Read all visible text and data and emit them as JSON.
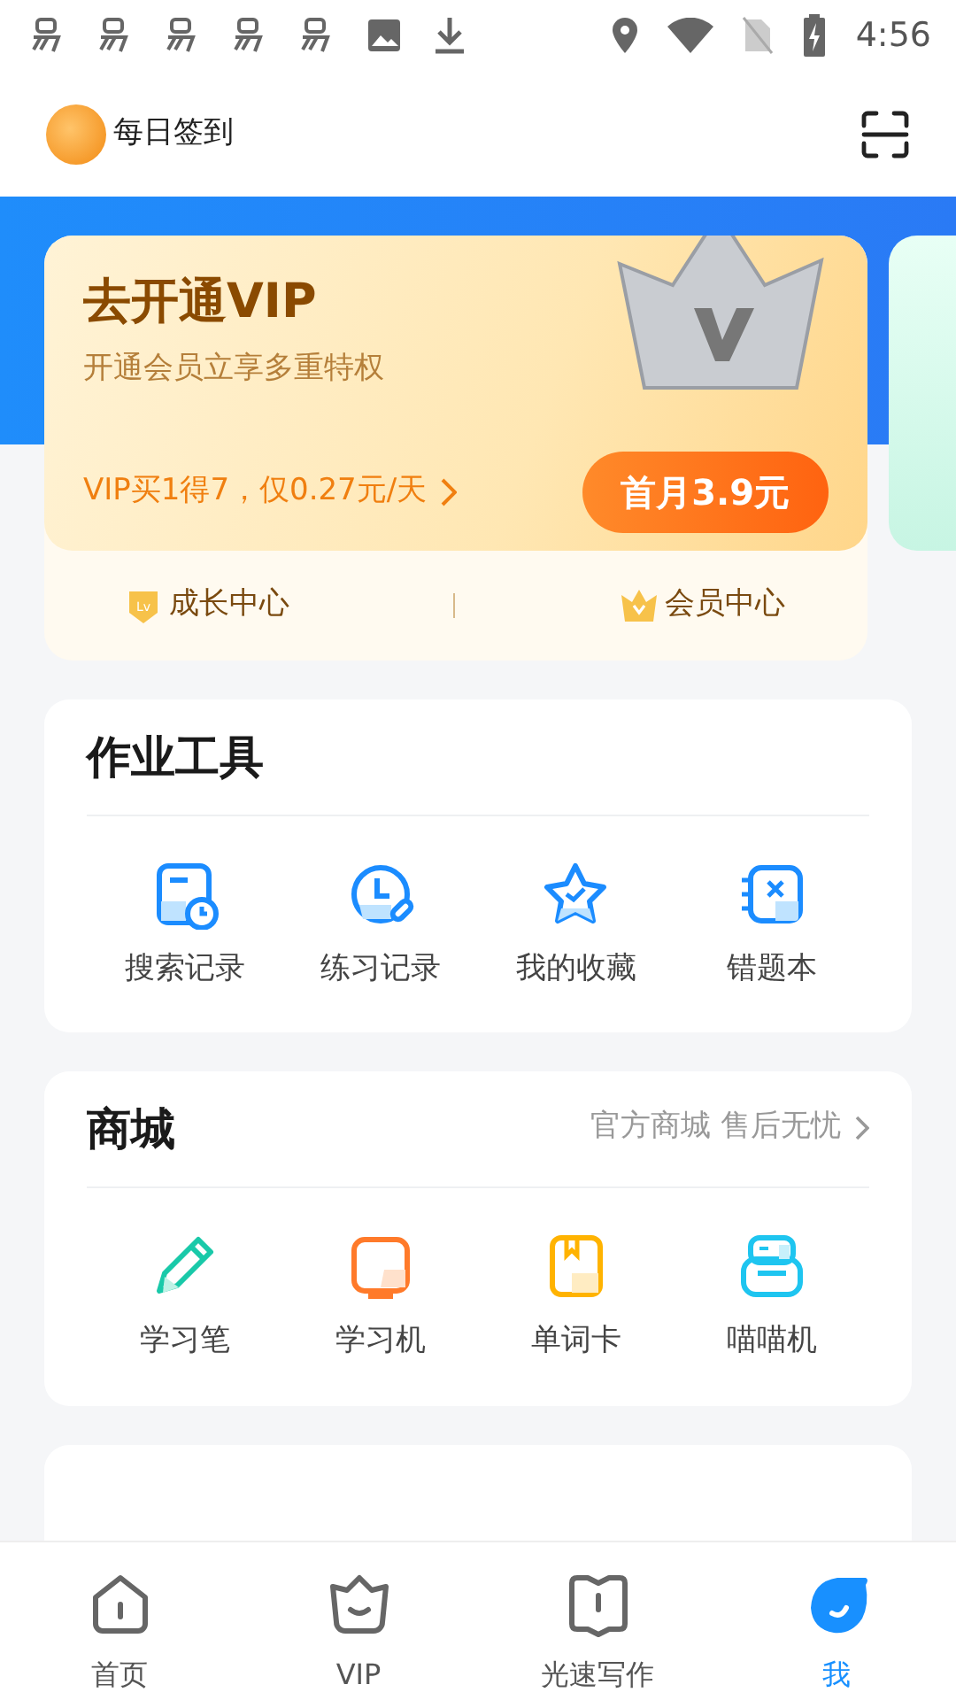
{
  "status_bar": {
    "time": "4:56"
  },
  "header": {
    "checkin_label": "每日签到"
  },
  "vip_card": {
    "title": "去开通VIP",
    "subtitle": "开通会员立享多重特权",
    "offer": "VIP买1得7，仅0.27元/天",
    "button": "首月3.9元",
    "level_badge": "Lv",
    "links": [
      "成长中心",
      "会员中心"
    ]
  },
  "homework_tools": {
    "title": "作业工具",
    "items": [
      {
        "label": "搜索记录",
        "kind": "search-history"
      },
      {
        "label": "练习记录",
        "kind": "practice"
      },
      {
        "label": "我的收藏",
        "kind": "favorites"
      },
      {
        "label": "错题本",
        "kind": "mistakes"
      }
    ]
  },
  "shop": {
    "title": "商城",
    "link": "官方商城 售后无忧",
    "items": [
      {
        "label": "学习笔",
        "kind": "pen"
      },
      {
        "label": "学习机",
        "kind": "tablet"
      },
      {
        "label": "单词卡",
        "kind": "cards"
      },
      {
        "label": "喵喵机",
        "kind": "printer"
      }
    ]
  },
  "tabs": [
    {
      "label": "首页",
      "kind": "home",
      "selected": false
    },
    {
      "label": "VIP",
      "kind": "vip",
      "selected": false
    },
    {
      "label": "光速写作",
      "kind": "write",
      "selected": false
    },
    {
      "label": "我",
      "kind": "me",
      "selected": true
    }
  ]
}
